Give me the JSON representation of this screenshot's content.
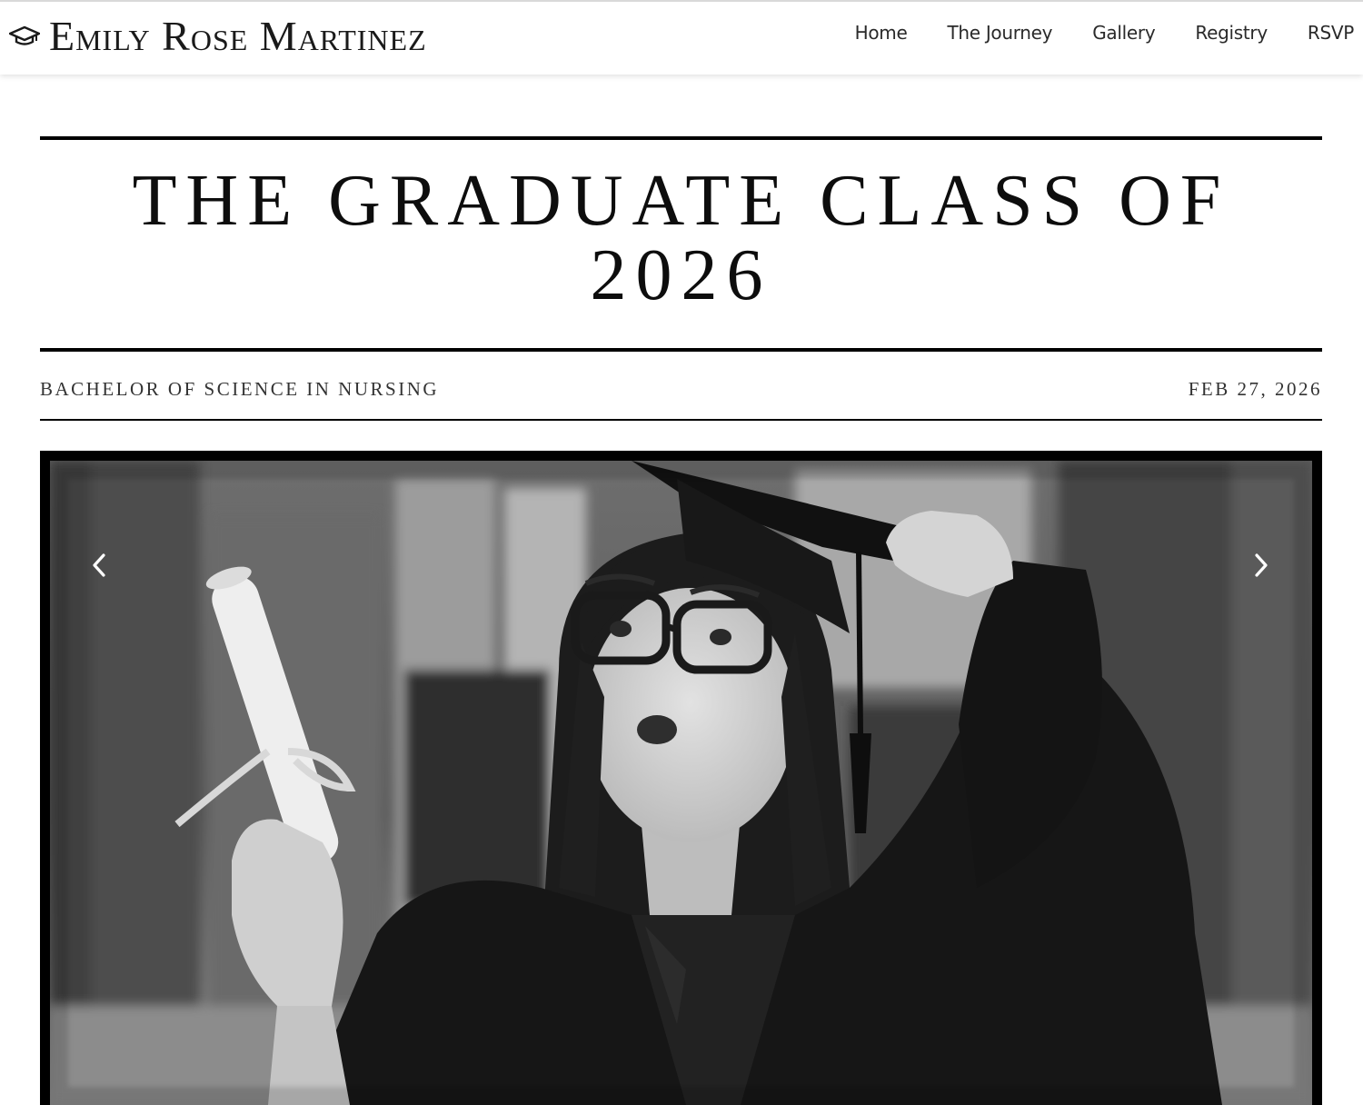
{
  "header": {
    "brand_icon": "graduation-cap-icon",
    "brand_name": "Emily Rose Martinez",
    "nav": [
      {
        "label": "Home"
      },
      {
        "label": "The Journey"
      },
      {
        "label": "Gallery"
      },
      {
        "label": "Registry"
      },
      {
        "label": "RSVP"
      }
    ]
  },
  "hero": {
    "title_line1": "THE GRADUATE CLASS OF",
    "title_line2": "2026",
    "degree": "BACHELOR OF SCIENCE IN NURSING",
    "date": "FEB 27, 2026"
  },
  "carousel": {
    "prev_icon": "chevron-left-icon",
    "next_icon": "chevron-right-icon",
    "photo_style": "black-and-white"
  }
}
